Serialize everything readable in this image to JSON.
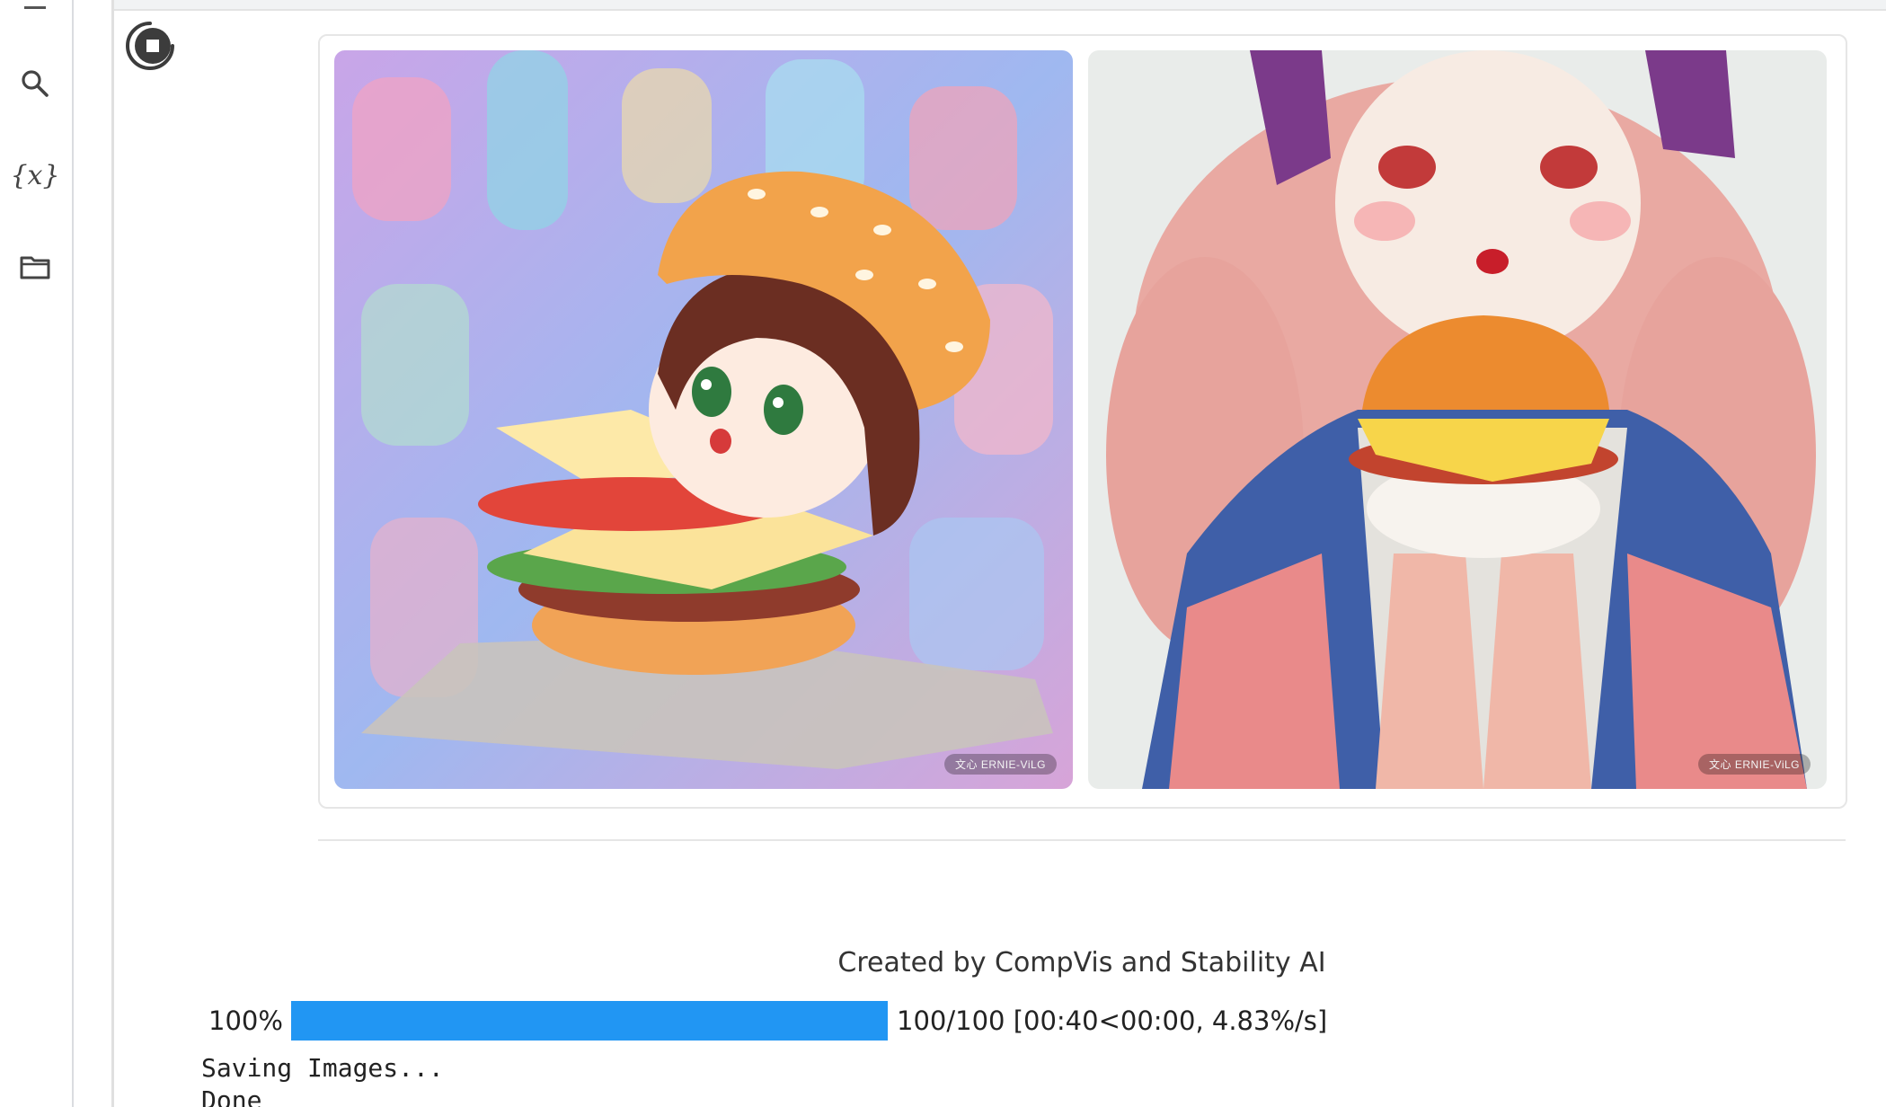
{
  "sidebar": {
    "icons": [
      "toc-icon",
      "search-icon",
      "variables-icon",
      "folder-icon"
    ],
    "variables_label": "{x}"
  },
  "output": {
    "images": [
      {
        "alt": "Watercolor chibi girl inside a hamburger",
        "watermark": "文心 ERNIE-ViLG"
      },
      {
        "alt": "Watercolor girl holding a hamburger",
        "watermark": "文心 ERNIE-ViLG"
      }
    ],
    "caption": "Created by CompVis and Stability AI"
  },
  "progress": {
    "percent_label": "100%",
    "fraction": 1.0,
    "stats": "100/100 [00:40<00:00, 4.83%/s]"
  },
  "console": {
    "lines": [
      "Saving Images...",
      "Done"
    ]
  },
  "colors": {
    "progress_fill": "#2196f3",
    "sidebar_border": "#dadce0"
  }
}
